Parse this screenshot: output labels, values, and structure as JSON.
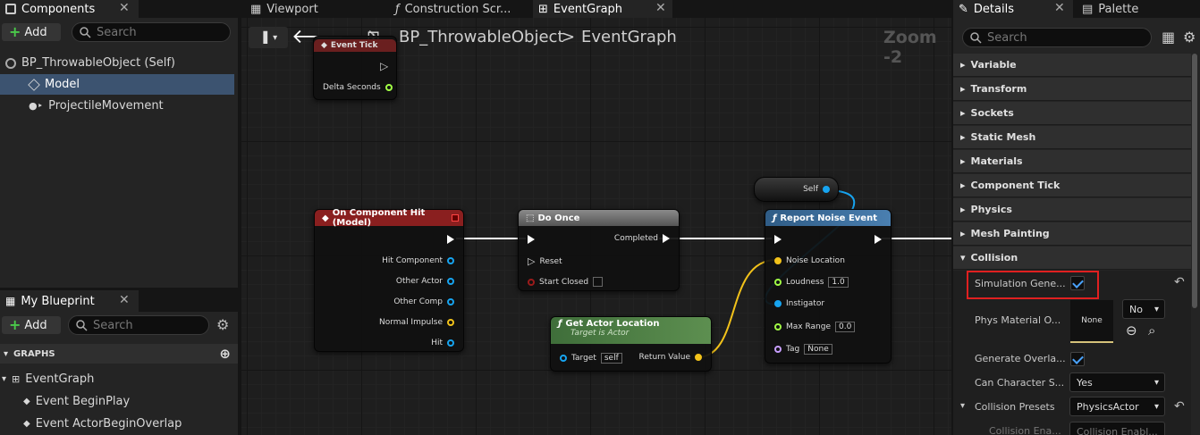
{
  "components_panel": {
    "title": "Components",
    "add_label": "Add",
    "search_placeholder": "Search",
    "tree": [
      {
        "label": "BP_ThrowableObject (Self)"
      },
      {
        "label": "Model"
      },
      {
        "label": "ProjectileMovement"
      }
    ]
  },
  "my_blueprint": {
    "title": "My Blueprint",
    "add_label": "Add",
    "search_placeholder": "Search",
    "section_graphs": "GRAPHS",
    "items": [
      {
        "label": "EventGraph"
      },
      {
        "label": "Event BeginPlay"
      },
      {
        "label": "Event ActorBeginOverlap"
      }
    ]
  },
  "editor_tabs": [
    {
      "label": "Viewport"
    },
    {
      "label": "Construction Scr..."
    },
    {
      "label": "EventGraph"
    }
  ],
  "graph": {
    "breadcrumb_blueprint": "BP_ThrowableObject",
    "breadcrumb_sep": ">",
    "breadcrumb_graph": "EventGraph",
    "zoom": "Zoom -2",
    "nodes": {
      "event_tick_title": "Event Tick",
      "delta_seconds": "Delta Seconds",
      "hit": {
        "title": "On Component Hit (Model)",
        "pins": [
          "Hit Component",
          "Other Actor",
          "Other Comp",
          "Normal Impulse",
          "Hit"
        ]
      },
      "do_once": {
        "title": "Do Once",
        "completed": "Completed",
        "reset": "Reset",
        "start_closed": "Start Closed"
      },
      "self_label": "Self",
      "report": {
        "title": "Report Noise Event",
        "noise_location": "Noise Location",
        "loudness": "Loudness",
        "loudness_value": "1.0",
        "instigator": "Instigator",
        "max_range": "Max Range",
        "max_range_value": "0.0",
        "tag": "Tag",
        "tag_value": "None"
      },
      "get_actor_location": {
        "title": "Get Actor Location",
        "subtitle": "Target is Actor",
        "target": "Target",
        "target_value": "self",
        "return_value": "Return Value"
      }
    }
  },
  "details_panel": {
    "title": "Details",
    "palette_title": "Palette",
    "search_placeholder": "Search",
    "categories": [
      "Variable",
      "Transform",
      "Sockets",
      "Static Mesh",
      "Materials",
      "Component Tick",
      "Physics",
      "Mesh Painting",
      "Collision"
    ],
    "properties": {
      "simulation_generates": {
        "label": "Simulation Gene...",
        "checked": true
      },
      "phys_material_override": {
        "label": "Phys Material O...",
        "thumbnail": "None",
        "dropdown": "No"
      },
      "generate_overlap": {
        "label": "Generate Overla...",
        "checked": true
      },
      "can_character_step": {
        "label": "Can Character S...",
        "value": "Yes"
      },
      "collision_presets": {
        "label": "Collision Presets",
        "value": "PhysicsActor"
      },
      "collision_enabled": {
        "label": "Collision Ena...",
        "value": "Collision Enabl..."
      }
    }
  },
  "colors": {
    "accent_select": "#3c5370",
    "hit_header": "#8a1f1f",
    "do_once_header": "#6f6f6f",
    "function_header": "#2f5c86",
    "pure_header": "#3f6e3a",
    "highlight_box": "#e02020",
    "vector_pin": "#f2c21a",
    "object_pin": "#17a4f0",
    "float_pin": "#a1ff45",
    "name_pin": "#c79eff"
  }
}
